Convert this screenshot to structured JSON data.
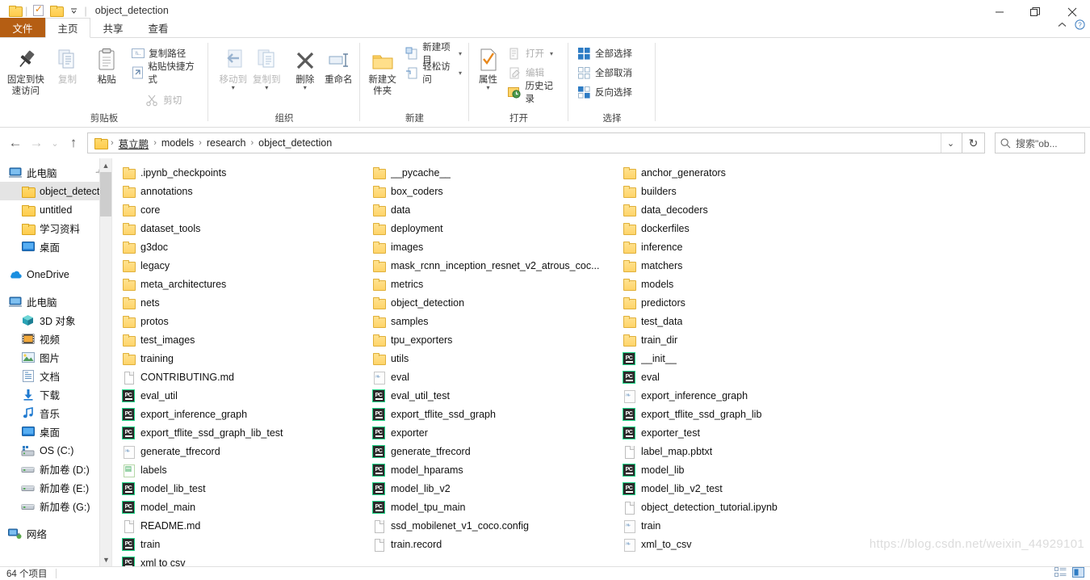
{
  "window": {
    "title": "object_detection",
    "quick_access": [
      "folder-icon",
      "checkbox-icon",
      "folder-icon",
      "dropdown-caret-icon"
    ],
    "controls": {
      "minimize": "minimize-icon",
      "restore": "restore-icon",
      "close": "close-icon"
    }
  },
  "tabs": [
    {
      "id": "file",
      "label": "文件"
    },
    {
      "id": "home",
      "label": "主页"
    },
    {
      "id": "share",
      "label": "共享"
    },
    {
      "id": "view",
      "label": "查看"
    }
  ],
  "ribbon": {
    "groups": [
      {
        "name": "clipboard",
        "label": "剪贴板",
        "big": [
          {
            "label": "固定到快速访问",
            "icon": "pin-icon",
            "disabled": false
          },
          {
            "label": "复制",
            "icon": "copy-icon",
            "disabled": true
          },
          {
            "label": "粘贴",
            "icon": "paste-icon",
            "disabled": false
          }
        ],
        "small_under_paste": [
          {
            "label": "剪切",
            "icon": "scissors-icon",
            "disabled": true
          }
        ],
        "small": [
          {
            "label": "复制路径",
            "icon": "copy-path-icon",
            "disabled": false
          },
          {
            "label": "粘贴快捷方式",
            "icon": "paste-shortcut-icon",
            "disabled": false
          }
        ]
      },
      {
        "name": "organize",
        "label": "组织",
        "big": [
          {
            "label": "移动到",
            "icon": "move-to-icon",
            "disabled": true,
            "split": true
          },
          {
            "label": "复制到",
            "icon": "copy-to-icon",
            "disabled": true,
            "split": true
          },
          {
            "label": "删除",
            "icon": "delete-icon",
            "disabled": false,
            "split": true
          },
          {
            "label": "重命名",
            "icon": "rename-icon",
            "disabled": false
          }
        ]
      },
      {
        "name": "new",
        "label": "新建",
        "big": [
          {
            "label": "新建文件夹",
            "icon": "new-folder-icon",
            "disabled": false
          }
        ],
        "small": [
          {
            "label": "新建项目",
            "icon": "new-item-icon",
            "split": true
          },
          {
            "label": "轻松访问",
            "icon": "easy-access-icon",
            "split": true
          }
        ]
      },
      {
        "name": "open",
        "label": "打开",
        "big": [
          {
            "label": "属性",
            "icon": "properties-icon",
            "split": true
          }
        ],
        "small": [
          {
            "label": "打开",
            "icon": "open-icon",
            "disabled": true,
            "split": true
          },
          {
            "label": "编辑",
            "icon": "edit-icon",
            "disabled": true
          },
          {
            "label": "历史记录",
            "icon": "history-icon",
            "disabled": false
          }
        ]
      },
      {
        "name": "select",
        "label": "选择",
        "small": [
          {
            "label": "全部选择",
            "icon": "select-all-icon"
          },
          {
            "label": "全部取消",
            "icon": "select-none-icon"
          },
          {
            "label": "反向选择",
            "icon": "invert-selection-icon"
          }
        ]
      }
    ],
    "collapse_hint": "collapse-ribbon-icon",
    "help_hint": "help-icon"
  },
  "address": {
    "back": "back-arrow-icon",
    "forward": "forward-arrow-icon",
    "recent": "recent-caret-icon",
    "up": "up-arrow-icon",
    "breadcrumbs": [
      "葛立鹏",
      "models",
      "research",
      "object_detection"
    ],
    "dropdown": "address-dropdown-icon",
    "refresh": "refresh-icon",
    "search_placeholder": "搜索\"ob...",
    "search_icon": "search-icon"
  },
  "navpane": {
    "items": [
      {
        "label": "此电脑",
        "icon": "computer-icon",
        "indent": 0,
        "selected": false,
        "pinned": true
      },
      {
        "label": "object_detectio",
        "icon": "folder-icon",
        "indent": 1,
        "selected": true
      },
      {
        "label": "untitled",
        "icon": "folder-icon",
        "indent": 1,
        "selected": false
      },
      {
        "label": "学习资料",
        "icon": "folder-icon",
        "indent": 1,
        "selected": false
      },
      {
        "label": "桌面",
        "icon": "desktop-icon",
        "indent": 1,
        "selected": false
      },
      {
        "gap": true
      },
      {
        "label": "OneDrive",
        "icon": "onedrive-icon",
        "indent": 0,
        "selected": false
      },
      {
        "gap": true
      },
      {
        "label": "此电脑",
        "icon": "computer-icon",
        "indent": 0,
        "selected": false
      },
      {
        "label": "3D 对象",
        "icon": "3d-objects-icon",
        "indent": 1,
        "selected": false
      },
      {
        "label": "视频",
        "icon": "videos-icon",
        "indent": 1,
        "selected": false
      },
      {
        "label": "图片",
        "icon": "pictures-icon",
        "indent": 1,
        "selected": false
      },
      {
        "label": "文档",
        "icon": "documents-icon",
        "indent": 1,
        "selected": false
      },
      {
        "label": "下载",
        "icon": "downloads-icon",
        "indent": 1,
        "selected": false
      },
      {
        "label": "音乐",
        "icon": "music-icon",
        "indent": 1,
        "selected": false
      },
      {
        "label": "桌面",
        "icon": "desktop-icon",
        "indent": 1,
        "selected": false
      },
      {
        "label": "OS (C:)",
        "icon": "os-drive-icon",
        "indent": 1,
        "selected": false
      },
      {
        "label": "新加卷 (D:)",
        "icon": "drive-icon",
        "indent": 1,
        "selected": false
      },
      {
        "label": "新加卷 (E:)",
        "icon": "drive-icon",
        "indent": 1,
        "selected": false
      },
      {
        "label": "新加卷 (G:)",
        "icon": "drive-icon",
        "indent": 1,
        "selected": false
      },
      {
        "gap": true
      },
      {
        "label": "网络",
        "icon": "network-icon",
        "indent": 0,
        "selected": false
      }
    ]
  },
  "files": {
    "columns": [
      [
        {
          "name": ".ipynb_checkpoints",
          "type": "folder"
        },
        {
          "name": "annotations",
          "type": "folder"
        },
        {
          "name": "core",
          "type": "folder"
        },
        {
          "name": "dataset_tools",
          "type": "folder"
        },
        {
          "name": "g3doc",
          "type": "folder"
        },
        {
          "name": "legacy",
          "type": "folder"
        },
        {
          "name": "meta_architectures",
          "type": "folder"
        },
        {
          "name": "nets",
          "type": "folder"
        },
        {
          "name": "protos",
          "type": "folder"
        },
        {
          "name": "test_images",
          "type": "folder"
        },
        {
          "name": "training",
          "type": "folder"
        },
        {
          "name": "CONTRIBUTING.md",
          "type": "doc"
        },
        {
          "name": "eval_util",
          "type": "python"
        },
        {
          "name": "export_inference_graph",
          "type": "python"
        },
        {
          "name": "export_tflite_ssd_graph_lib_test",
          "type": "python"
        },
        {
          "name": "generate_tfrecord",
          "type": "pyc"
        },
        {
          "name": "labels",
          "type": "xml"
        },
        {
          "name": "model_lib_test",
          "type": "python"
        },
        {
          "name": "model_main",
          "type": "python"
        },
        {
          "name": "README.md",
          "type": "doc"
        },
        {
          "name": "train",
          "type": "python"
        },
        {
          "name": "xml to csv",
          "type": "python"
        }
      ],
      [
        {
          "name": "__pycache__",
          "type": "folder"
        },
        {
          "name": "box_coders",
          "type": "folder"
        },
        {
          "name": "data",
          "type": "folder"
        },
        {
          "name": "deployment",
          "type": "folder"
        },
        {
          "name": "images",
          "type": "folder"
        },
        {
          "name": "mask_rcnn_inception_resnet_v2_atrous_coc...",
          "type": "folder"
        },
        {
          "name": "metrics",
          "type": "folder"
        },
        {
          "name": "object_detection",
          "type": "folder"
        },
        {
          "name": "samples",
          "type": "folder"
        },
        {
          "name": "tpu_exporters",
          "type": "folder"
        },
        {
          "name": "utils",
          "type": "folder"
        },
        {
          "name": "eval",
          "type": "pyc"
        },
        {
          "name": "eval_util_test",
          "type": "python"
        },
        {
          "name": "export_tflite_ssd_graph",
          "type": "python"
        },
        {
          "name": "exporter",
          "type": "python"
        },
        {
          "name": "generate_tfrecord",
          "type": "python"
        },
        {
          "name": "model_hparams",
          "type": "python"
        },
        {
          "name": "model_lib_v2",
          "type": "python"
        },
        {
          "name": "model_tpu_main",
          "type": "python"
        },
        {
          "name": "ssd_mobilenet_v1_coco.config",
          "type": "doc"
        },
        {
          "name": "train.record",
          "type": "doc"
        }
      ],
      [
        {
          "name": "anchor_generators",
          "type": "folder"
        },
        {
          "name": "builders",
          "type": "folder"
        },
        {
          "name": "data_decoders",
          "type": "folder"
        },
        {
          "name": "dockerfiles",
          "type": "folder"
        },
        {
          "name": "inference",
          "type": "folder"
        },
        {
          "name": "matchers",
          "type": "folder"
        },
        {
          "name": "models",
          "type": "folder"
        },
        {
          "name": "predictors",
          "type": "folder"
        },
        {
          "name": "test_data",
          "type": "folder"
        },
        {
          "name": "train_dir",
          "type": "folder"
        },
        {
          "name": "__init__",
          "type": "python"
        },
        {
          "name": "eval",
          "type": "python"
        },
        {
          "name": "export_inference_graph",
          "type": "pyc"
        },
        {
          "name": "export_tflite_ssd_graph_lib",
          "type": "python"
        },
        {
          "name": "exporter_test",
          "type": "python"
        },
        {
          "name": "label_map.pbtxt",
          "type": "doc"
        },
        {
          "name": "model_lib",
          "type": "python"
        },
        {
          "name": "model_lib_v2_test",
          "type": "python"
        },
        {
          "name": "object_detection_tutorial.ipynb",
          "type": "doc"
        },
        {
          "name": "train",
          "type": "pyc"
        },
        {
          "name": "xml_to_csv",
          "type": "pyc"
        }
      ]
    ]
  },
  "status": {
    "item_count": "64 个项目",
    "view_details_icon": "details-view-icon",
    "view_icons_icon": "large-icons-view-icon"
  },
  "watermark": "https://blog.csdn.net/weixin_44929101",
  "colors": {
    "file_tab": "#b55e13",
    "folder": "#ffd469",
    "selection": "#e4e4e4",
    "python_accent": "#21d789"
  }
}
